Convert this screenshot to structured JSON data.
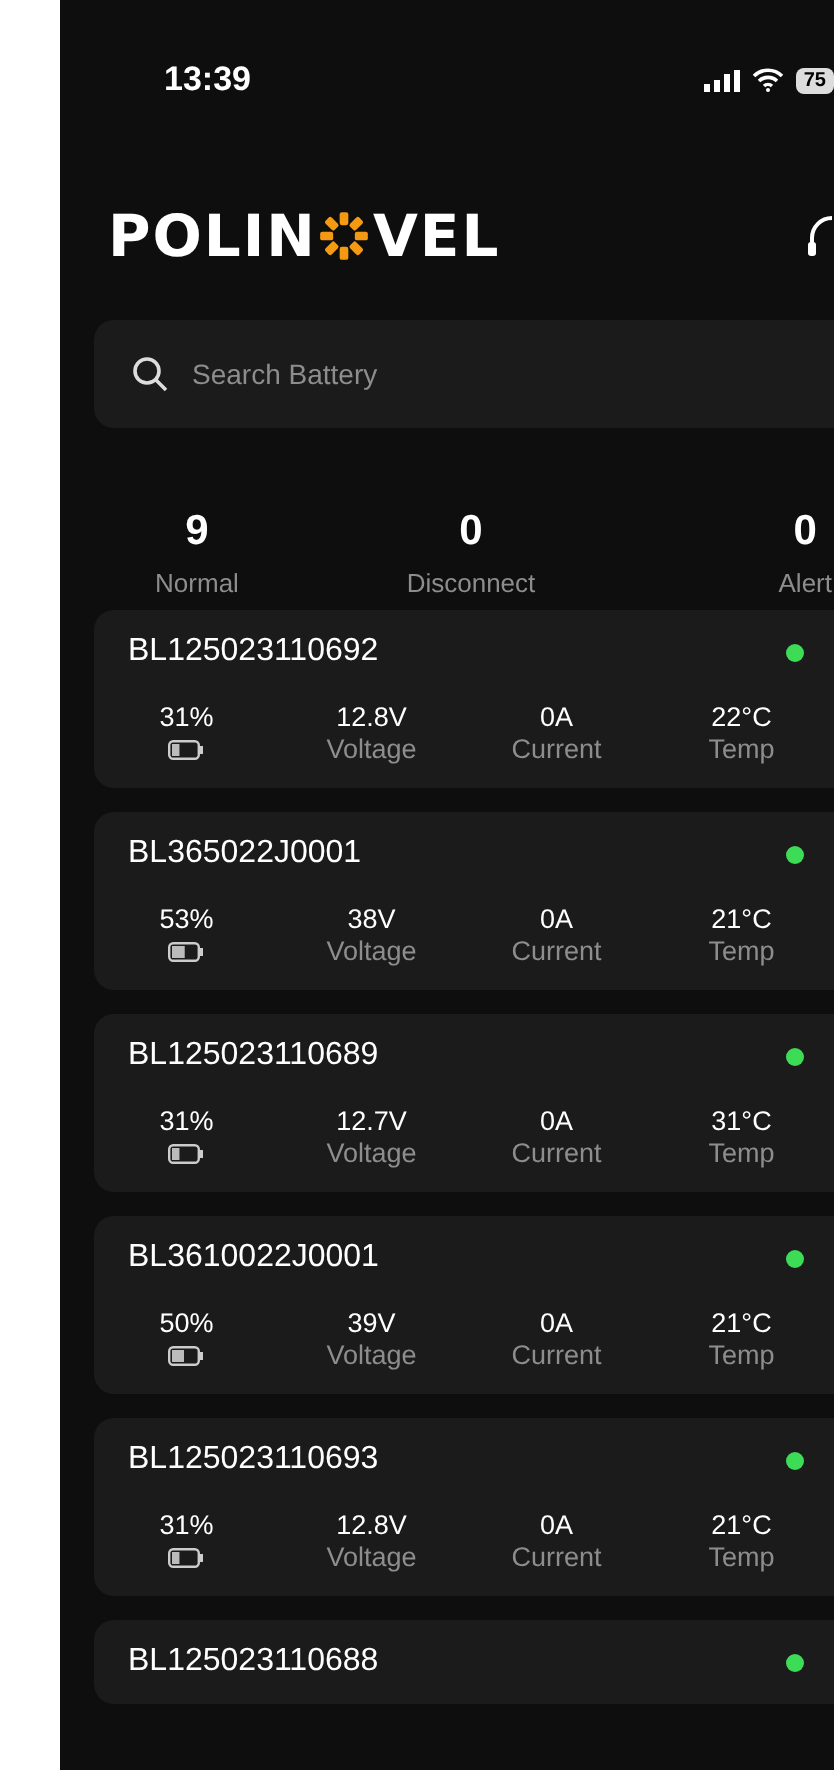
{
  "status_bar": {
    "time": "13:39",
    "battery": "75"
  },
  "header": {
    "logo_start": "POLIN",
    "logo_end": "VEL"
  },
  "search": {
    "placeholder": "Search Battery"
  },
  "summary": [
    {
      "count": "9",
      "label": "Normal"
    },
    {
      "count": "0",
      "label": "Disconnect"
    },
    {
      "count": "0",
      "label": "Alert"
    }
  ],
  "batteries": [
    {
      "id": "BL125023110692",
      "color": "#3ddc57",
      "soc": "31%",
      "level": 0.31,
      "voltage": "12.8V",
      "voltage_label": "Voltage",
      "current": "0A",
      "current_label": "Current",
      "temp": "22°C",
      "temp_label": "Temp"
    },
    {
      "id": "BL365022J0001",
      "color": "#3ddc57",
      "soc": "53%",
      "level": 0.53,
      "voltage": "38V",
      "voltage_label": "Voltage",
      "current": "0A",
      "current_label": "Current",
      "temp": "21°C",
      "temp_label": "Temp"
    },
    {
      "id": "BL125023110689",
      "color": "#3ddc57",
      "soc": "31%",
      "level": 0.31,
      "voltage": "12.7V",
      "voltage_label": "Voltage",
      "current": "0A",
      "current_label": "Current",
      "temp": "31°C",
      "temp_label": "Temp"
    },
    {
      "id": "BL3610022J0001",
      "color": "#3ddc57",
      "soc": "50%",
      "level": 0.5,
      "voltage": "39V",
      "voltage_label": "Voltage",
      "current": "0A",
      "current_label": "Current",
      "temp": "21°C",
      "temp_label": "Temp"
    },
    {
      "id": "BL125023110693",
      "color": "#3ddc57",
      "soc": "31%",
      "level": 0.31,
      "voltage": "12.8V",
      "voltage_label": "Voltage",
      "current": "0A",
      "current_label": "Current",
      "temp": "21°C",
      "temp_label": "Temp"
    },
    {
      "id": "BL125023110688",
      "color": "#3ddc57"
    }
  ]
}
